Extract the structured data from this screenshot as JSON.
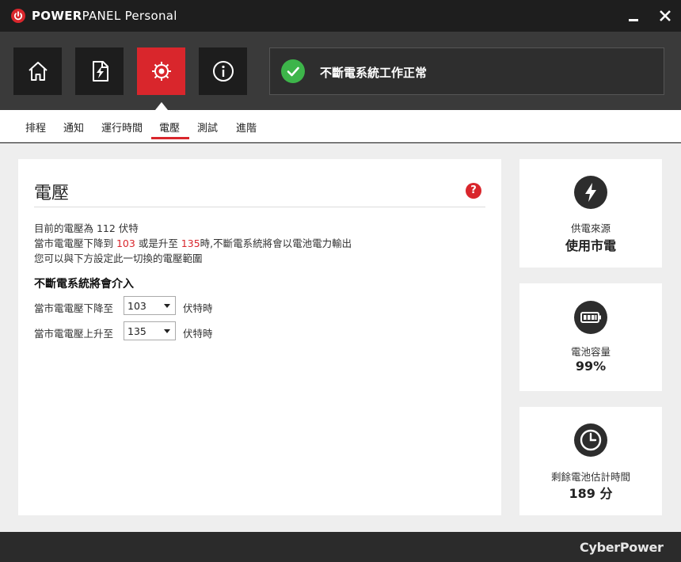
{
  "window": {
    "title_bold": "POWER",
    "title_rest": "PANEL Personal"
  },
  "nav": {
    "buttons": [
      {
        "name": "home",
        "icon": "home-icon"
      },
      {
        "name": "power",
        "icon": "power-document-icon"
      },
      {
        "name": "settings",
        "icon": "gear-icon",
        "active": true
      },
      {
        "name": "info",
        "icon": "info-icon"
      }
    ]
  },
  "status": {
    "icon": "check-circle-icon",
    "text": "不斷電系統工作正常",
    "color": "#3db54a"
  },
  "tabs": [
    "排程",
    "通知",
    "運行時間",
    "電壓",
    "測試",
    "進階"
  ],
  "active_tab": "電壓",
  "panel": {
    "title": "電壓",
    "info_line1_prefix": "目前的電壓為 112 伏特",
    "info_line2_a": "當市電電壓下降到 ",
    "info_line2_low": "103",
    "info_line2_b": " 或是升至 ",
    "info_line2_high": "135",
    "info_line2_c": "時,不斷電系統將會以電池電力輸出",
    "info_line3": "您可以與下方設定此一切換的電壓範圍",
    "section_title": "不斷電系統將會介入",
    "low_label": "當市電電壓下降至",
    "low_value": "103",
    "high_label": "當市電電壓上升至",
    "high_value": "135",
    "unit": "伏特時"
  },
  "cards": {
    "power_source": {
      "label": "供電來源",
      "value": "使用市電",
      "icon": "lightning-icon"
    },
    "battery": {
      "label": "電池容量",
      "value": "99%",
      "icon": "battery-icon"
    },
    "runtime": {
      "label": "剩餘電池估計時間",
      "value": "189 分",
      "icon": "clock-icon"
    }
  },
  "footer": {
    "brand": "CyberPower"
  },
  "colors": {
    "accent": "#d9262c",
    "ok": "#3db54a"
  }
}
